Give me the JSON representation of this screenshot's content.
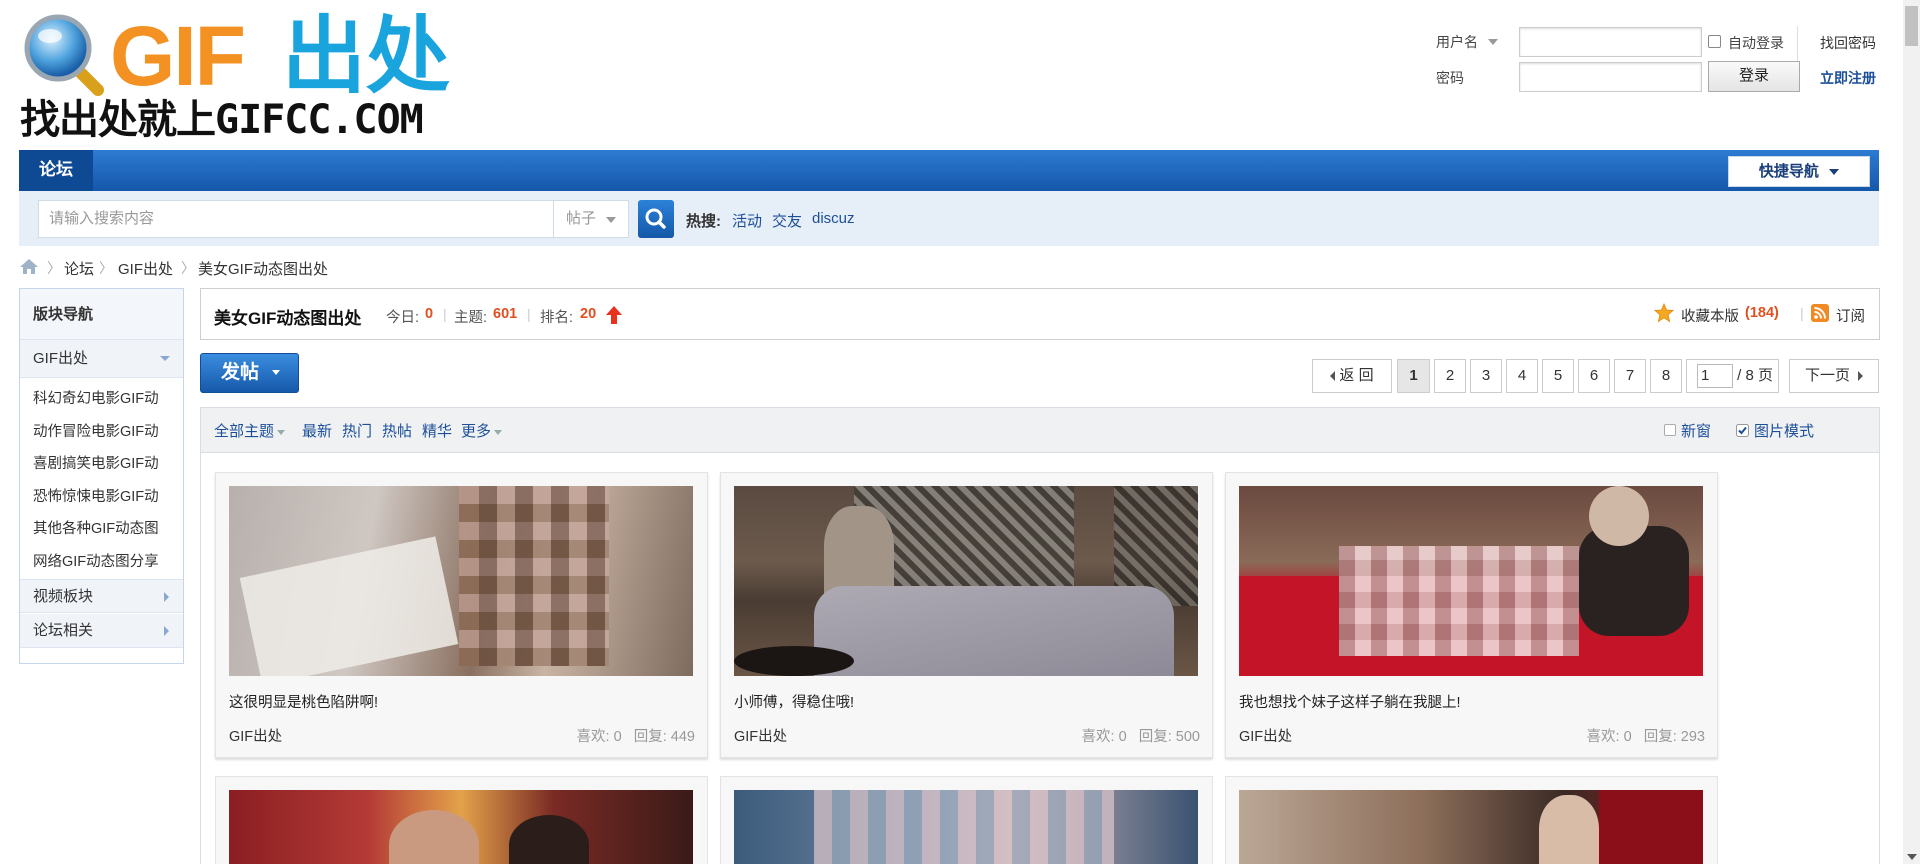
{
  "header": {
    "logo_text_gif": "GIF",
    "logo_text_cn": "出处",
    "slogan": "找出处就上GIFCC.COM"
  },
  "login": {
    "username_label": "用户名",
    "password_label": "密码",
    "auto_login": "自动登录",
    "login_button": "登录",
    "find_password": "找回密码",
    "register": "立即注册"
  },
  "nav": {
    "forum_tab": "论坛",
    "quick_nav": "快捷导航"
  },
  "search": {
    "placeholder": "请输入搜索内容",
    "type": "帖子",
    "hot_label": "热搜:",
    "hot_items": [
      "活动",
      "交友",
      "discuz"
    ]
  },
  "breadcrumb": [
    "论坛",
    "GIF出处",
    "美女GIF动态图出处"
  ],
  "sidebar": {
    "title": "版块导航",
    "group1": "GIF出处",
    "items": [
      "科幻奇幻电影GIF动",
      "动作冒险电影GIF动",
      "喜剧搞笑电影GIF动",
      "恐怖惊悚电影GIF动",
      "其他各种GIF动态图",
      "网络GIF动态图分享"
    ],
    "group2": "视频板块",
    "group3": "论坛相关"
  },
  "forum": {
    "title": "美女GIF动态图出处",
    "today_label": "今日:",
    "today": "0",
    "topics_label": "主题:",
    "topics": "601",
    "rank_label": "排名:",
    "rank": "20",
    "favorite_label": "收藏本版",
    "favorite_count": "(184)",
    "subscribe": "订阅"
  },
  "toolbar": {
    "post_button": "发帖",
    "back": "返 回",
    "pages": [
      "1",
      "2",
      "3",
      "4",
      "5",
      "6",
      "7",
      "8"
    ],
    "page_input": "1",
    "page_total": "/ 8 页",
    "next": "下一页"
  },
  "filters": {
    "all": "全部主题",
    "latest": "最新",
    "hot": "热门",
    "hot_posts": "热帖",
    "digest": "精华",
    "more": "更多",
    "new_window": "新窗",
    "image_mode": "图片模式"
  },
  "posts": [
    {
      "title": "这很明显是桃色陷阱啊!",
      "forum": "GIF出处",
      "likes": "喜欢: 0",
      "replies": "回复: 449"
    },
    {
      "title": "小师傅，得稳住哦!",
      "forum": "GIF出处",
      "likes": "喜欢: 0",
      "replies": "回复: 500"
    },
    {
      "title": "我也想找个妹子这样子躺在我腿上!",
      "forum": "GIF出处",
      "likes": "喜欢: 0",
      "replies": "回复: 293"
    }
  ],
  "colors": {
    "nav_blue": "#1d6ac4",
    "link_blue": "#1d4f99",
    "stat_red": "#e05020",
    "logo_orange": "#f39223",
    "logo_blue": "#1aa4de"
  }
}
